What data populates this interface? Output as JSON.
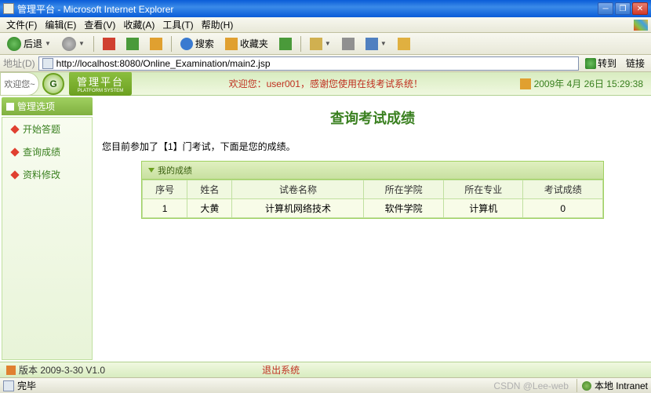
{
  "window": {
    "title": "管理平台 - Microsoft Internet Explorer"
  },
  "menu": {
    "file": "文件(F)",
    "edit": "编辑(E)",
    "view": "查看(V)",
    "favorites": "收藏(A)",
    "tools": "工具(T)",
    "help": "帮助(H)"
  },
  "toolbar": {
    "back": "后退",
    "search": "搜索",
    "favorites": "收藏夹"
  },
  "address": {
    "label": "地址(D)",
    "url": "http://localhost:8080/Online_Examination/main2.jsp",
    "go": "转到",
    "links": "链接"
  },
  "banner": {
    "welcome": "欢迎您~",
    "brand": "管理平台",
    "brand_sub": "PLATFORM SYSTEM",
    "message": "欢迎您：user001，感谢您使用在线考试系统！",
    "datetime": "2009年 4月 26日 15:29:38"
  },
  "sidebar": {
    "header": "管理选项",
    "items": [
      {
        "label": "开始答题"
      },
      {
        "label": "查询成绩"
      },
      {
        "label": "资料修改"
      }
    ]
  },
  "page": {
    "title": "查询考试成绩",
    "intro": "您目前参加了【1】门考试，下面是您的成绩。",
    "table_caption": "我的成绩",
    "columns": [
      "序号",
      "姓名",
      "试卷名称",
      "所在学院",
      "所在专业",
      "考试成绩"
    ],
    "rows": [
      {
        "no": "1",
        "name": "大黄",
        "paper": "计算机网络技术",
        "college": "软件学院",
        "major": "计算机",
        "score": "0"
      }
    ]
  },
  "footer": {
    "version": "版本 2009-3-30 V1.0",
    "logout": "退出系统"
  },
  "status": {
    "done": "完毕",
    "watermark": "CSDN @Lee-web",
    "zone": "本地 Intranet"
  }
}
